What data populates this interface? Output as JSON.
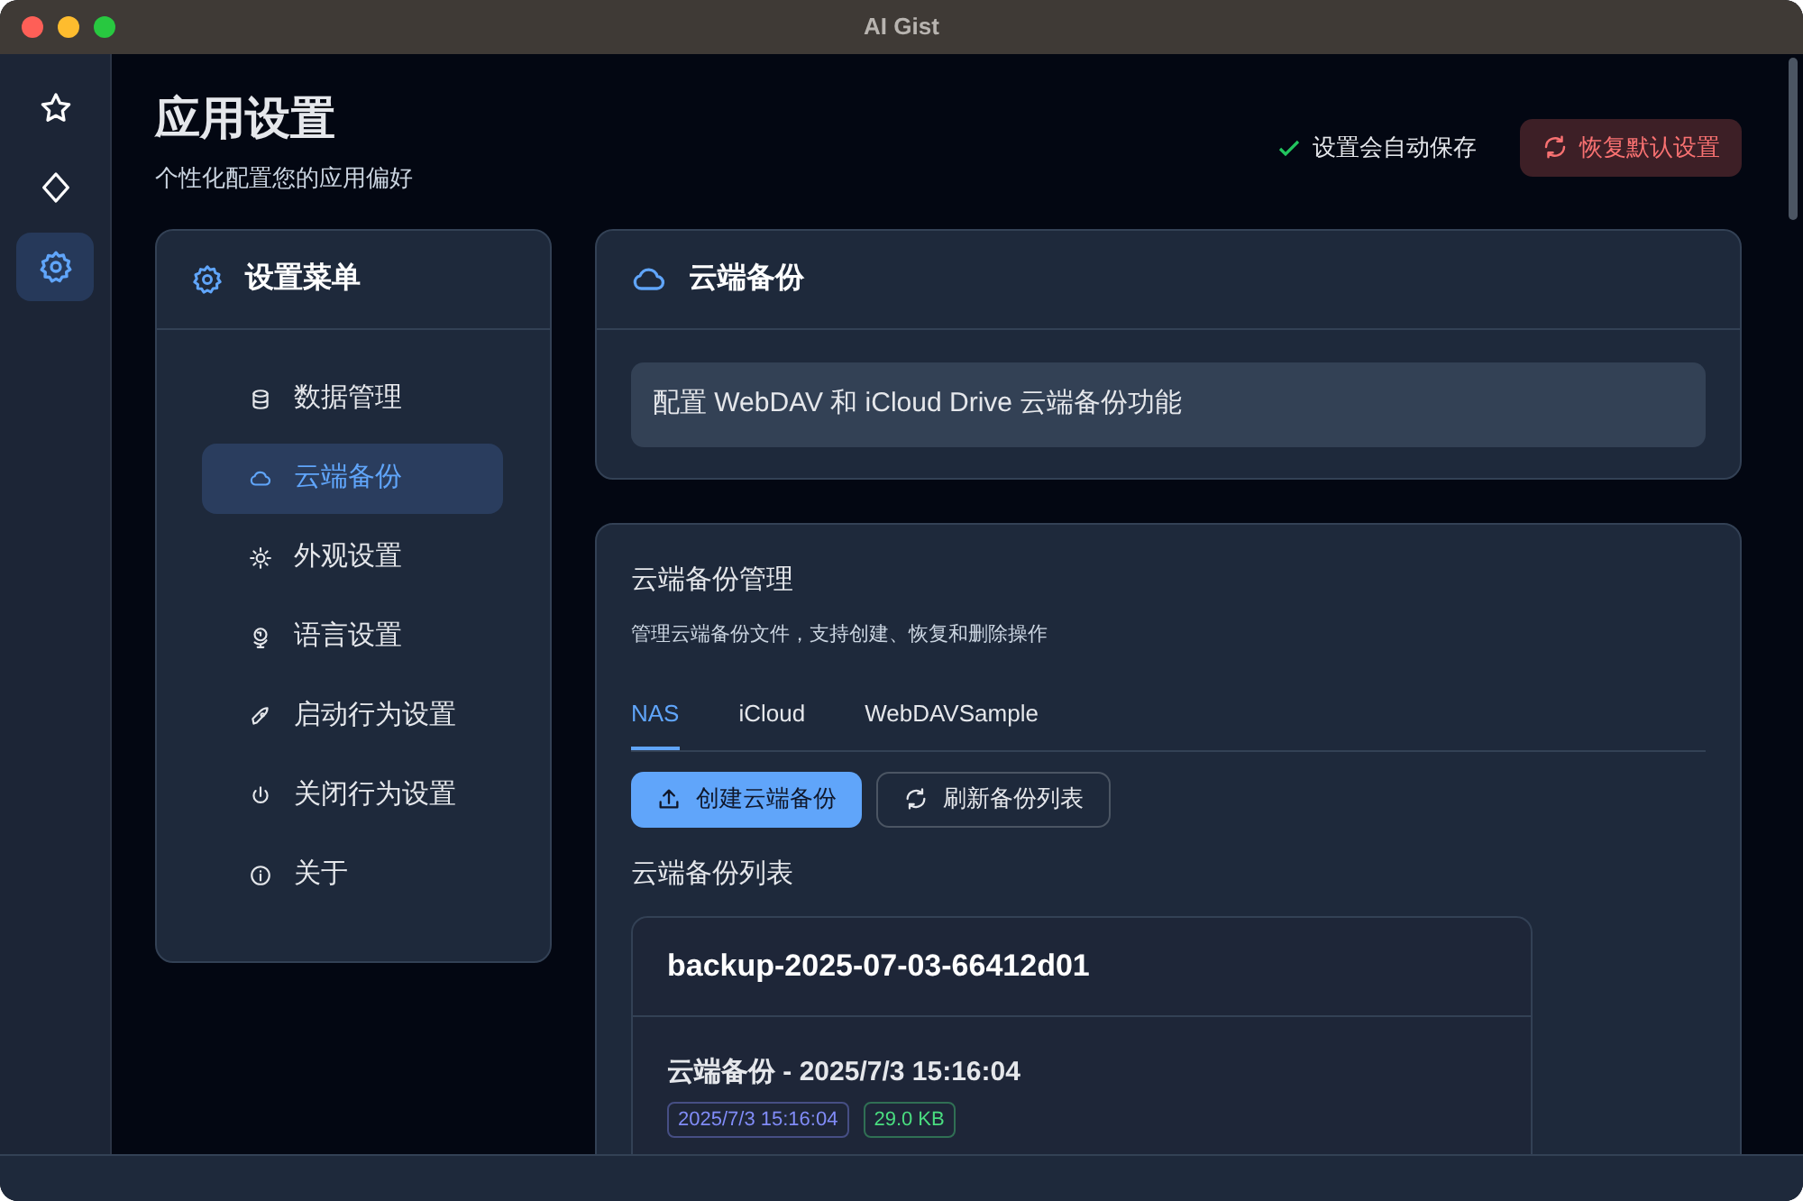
{
  "window": {
    "title": "AI Gist"
  },
  "rail": [
    {
      "selected": false
    },
    {
      "selected": false
    },
    {
      "selected": true
    }
  ],
  "header": {
    "title": "应用设置",
    "subtitle": "个性化配置您的应用偏好",
    "autosave": "设置会自动保存",
    "reset_button": "恢复默认设置"
  },
  "menu": {
    "title": "设置菜单",
    "items": [
      {
        "label": "数据管理",
        "selected": false
      },
      {
        "label": "云端备份",
        "selected": true
      },
      {
        "label": "外观设置",
        "selected": false
      },
      {
        "label": "语言设置",
        "selected": false
      },
      {
        "label": "启动行为设置",
        "selected": false
      },
      {
        "label": "关闭行为设置",
        "selected": false
      },
      {
        "label": "关于",
        "selected": false
      }
    ]
  },
  "section": {
    "title": "云端备份",
    "description": "配置 WebDAV 和 iCloud Drive 云端备份功能"
  },
  "manager": {
    "title": "云端备份管理",
    "description": "管理云端备份文件，支持创建、恢复和删除操作",
    "tabs": [
      {
        "label": "NAS",
        "selected": true
      },
      {
        "label": "iCloud",
        "selected": false
      },
      {
        "label": "WebDAVSample",
        "selected": false
      }
    ],
    "buttons": [
      {
        "kind": "primary",
        "label": "创建云端备份"
      },
      {
        "kind": "outline",
        "label": "刷新备份列表"
      }
    ],
    "list_title": "云端备份列表",
    "backups": [
      {
        "name": "backup-2025-07-03-66412d01",
        "title": "云端备份 - 2025/7/3 15:16:04",
        "tags": [
          {
            "label": "2025/7/3 15:16:04",
            "color": "#818cf8"
          },
          {
            "label": "29.0 KB",
            "color": "#4ade80"
          }
        ]
      }
    ]
  }
}
